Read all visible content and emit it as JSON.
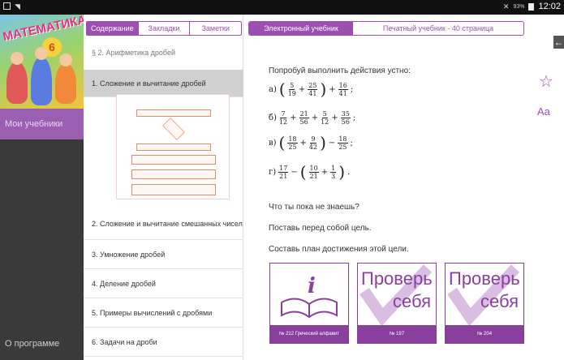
{
  "status_bar": {
    "battery": "93%",
    "time": "12:02"
  },
  "sidebar": {
    "cover_title": "МАТЕМАТИКА",
    "cover_grade": "6",
    "my_books": "Мои учебники",
    "about": "О программе"
  },
  "toc": {
    "segments": [
      "Содержание",
      "Закладки",
      "Заметки"
    ],
    "section_title": "§ 2. Арифметика дробей",
    "items": [
      "1. Сложение и вычитание дробей",
      "2. Сложение и вычитание смешанных чисел",
      "3. Умножение дробей",
      "4. Деление дробей",
      "5. Примеры вычислений с дробями",
      "6. Задачи на дроби"
    ]
  },
  "reader": {
    "tabs": [
      "Электронный учебник",
      "Печатный учебник - 40 страница"
    ],
    "intro": "Попробуй выполнить действия устно:",
    "labels": [
      "а)",
      "б)",
      "в)",
      "г)"
    ],
    "q1": "Что ты пока не знаешь?",
    "q2": "Поставь перед собой цель.",
    "q3": "Составь план достижения этой цели.",
    "cards": [
      {
        "caption": "№ 212 Греческий алфавит"
      },
      {
        "line1": "Проверь",
        "line2": "себя",
        "caption": "№ 197"
      },
      {
        "line1": "Проверь",
        "line2": "себя",
        "caption": "№ 204"
      }
    ]
  },
  "tools": {
    "font_label": "Aa"
  },
  "colors": {
    "accent": "#9b4fb0",
    "sidebar": "#3a3a3a",
    "statusbar": "#111111"
  }
}
